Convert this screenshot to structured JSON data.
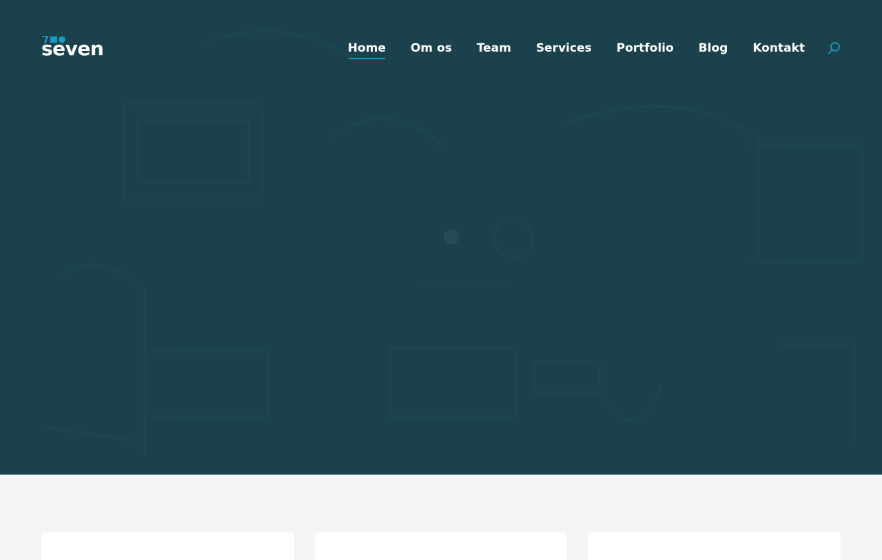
{
  "brand": {
    "name": "seven",
    "accent_color": "#1d9ac0",
    "logo_marks": [
      "seven-digit-icon",
      "square-icon",
      "circle-icon"
    ]
  },
  "nav": {
    "items": [
      {
        "label": "Home",
        "active": true
      },
      {
        "label": "Om os",
        "active": false
      },
      {
        "label": "Team",
        "active": false
      },
      {
        "label": "Services",
        "active": false
      },
      {
        "label": "Portfolio",
        "active": false
      },
      {
        "label": "Blog",
        "active": false
      },
      {
        "label": "Kontakt",
        "active": false
      }
    ],
    "search_icon": "search-icon"
  },
  "hero": {
    "background_color": "#1b414c",
    "loader_icon": "loading-dot-icon"
  },
  "page": {
    "background_color": "#f4f4f6",
    "card_count": 3
  }
}
